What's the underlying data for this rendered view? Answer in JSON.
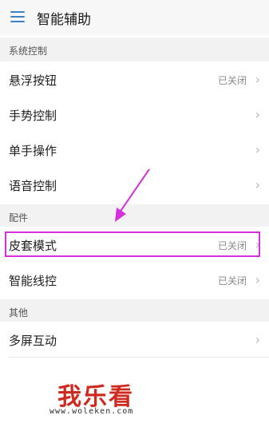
{
  "header": {
    "title": "智能辅助"
  },
  "sections": [
    {
      "title": "系统控制",
      "items": [
        {
          "label": "悬浮按钮",
          "status": "已关闭"
        },
        {
          "label": "手势控制",
          "status": ""
        },
        {
          "label": "单手操作",
          "status": ""
        },
        {
          "label": "语音控制",
          "status": ""
        }
      ]
    },
    {
      "title": "配件",
      "items": [
        {
          "label": "皮套模式",
          "status": "已关闭"
        },
        {
          "label": "智能线控",
          "status": "已关闭"
        }
      ]
    },
    {
      "title": "其他",
      "items": [
        {
          "label": "多屏互动",
          "status": ""
        }
      ]
    }
  ],
  "chevron": "›",
  "annotation_color": "#d62fdc",
  "watermark": {
    "brand": "我乐看",
    "url": "www.woleken.com"
  }
}
